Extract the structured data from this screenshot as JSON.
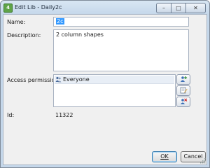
{
  "window": {
    "title": "Edit Lib - Daily2c",
    "app_icon_glyph": "4",
    "controls": {
      "minimize": "–",
      "maximize": "□",
      "close": "✕"
    }
  },
  "form": {
    "name_label": "Name:",
    "name_value": "2c",
    "description_label": "Description:",
    "description_value": "2 column shapes",
    "access_label": "Access permissions:",
    "permissions": [
      {
        "icon": "users-icon",
        "label": "Everyone"
      }
    ],
    "side_buttons": [
      "add-user-icon",
      "edit-permission-icon",
      "remove-user-icon"
    ],
    "id_label": "Id:",
    "id_value": "11322"
  },
  "buttons": {
    "ok": "OK",
    "cancel": "Cancel"
  },
  "colors": {
    "accent": "#3399ff",
    "titlebar": "#c5d7ea",
    "client": "#f0f0f0"
  }
}
